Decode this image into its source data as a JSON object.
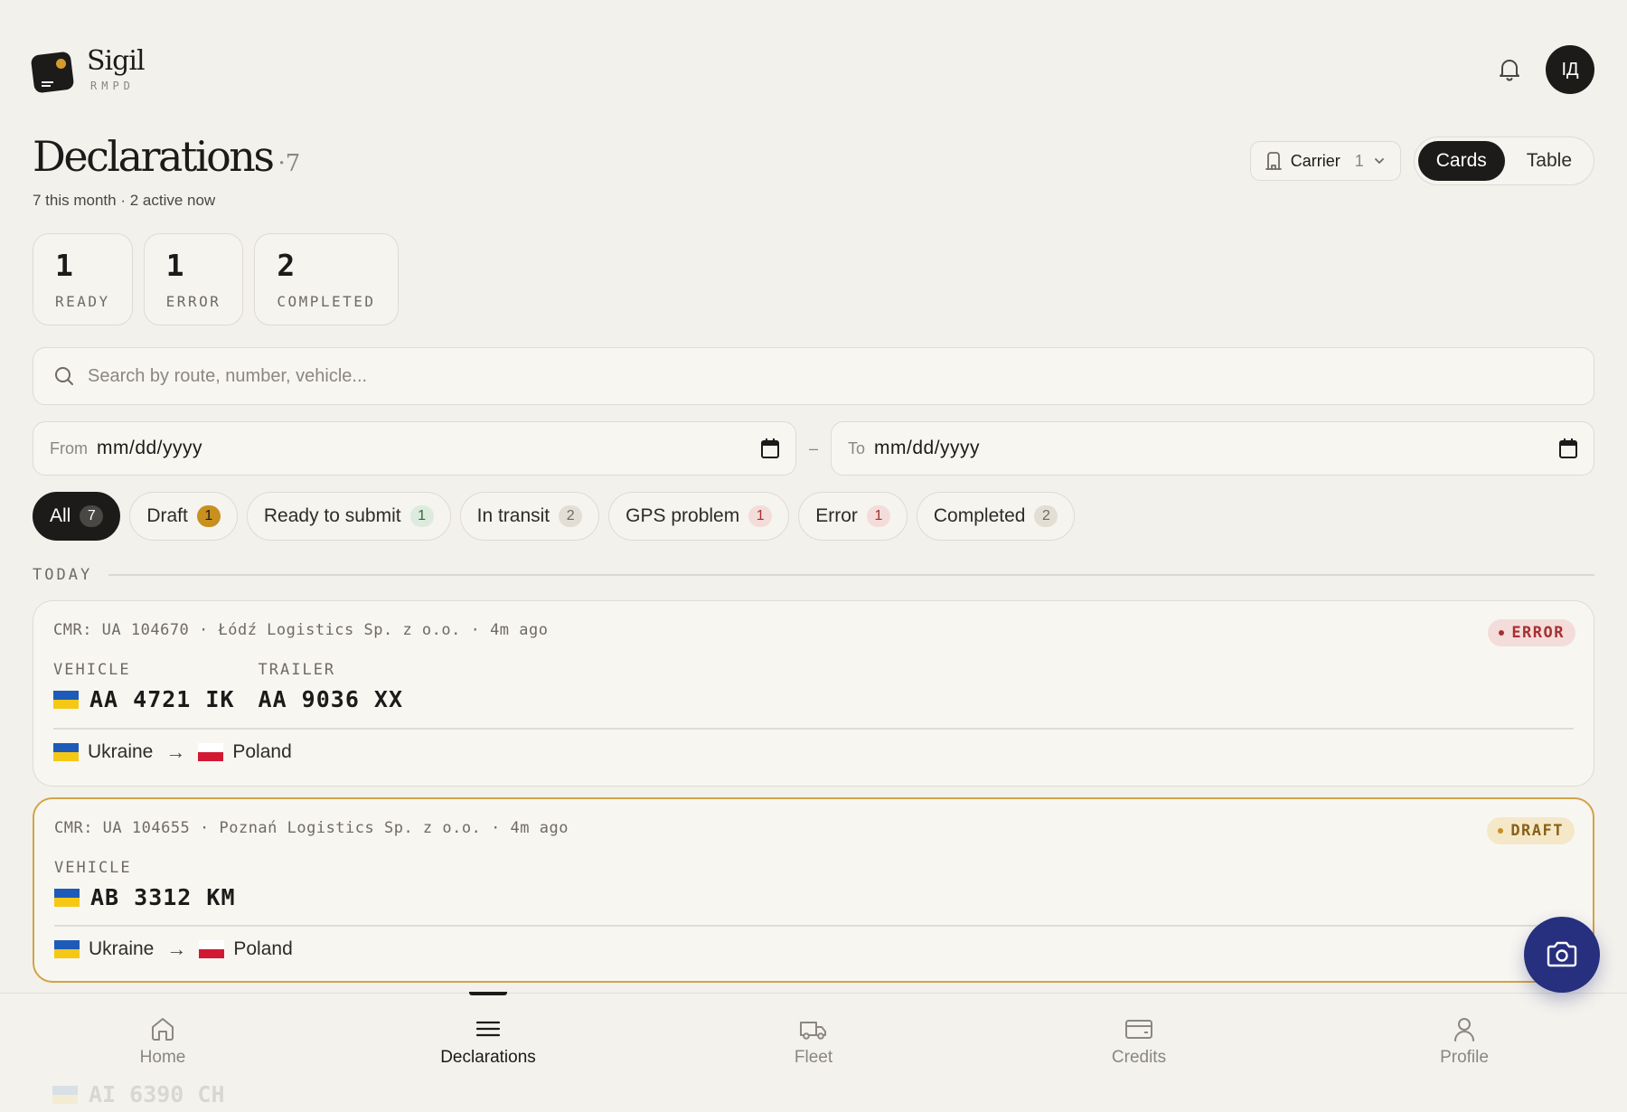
{
  "brand": {
    "name": "Sigil",
    "sub": "RMPD"
  },
  "user": {
    "initials": "ІД"
  },
  "page": {
    "title": "Declarations",
    "count": "·7",
    "subtitle": "7 this month · 2 active now"
  },
  "carrier": {
    "label": "Carrier",
    "count": "1"
  },
  "view_toggle": {
    "options": [
      "Cards",
      "Table"
    ],
    "active": "Cards"
  },
  "stats": [
    {
      "value": "1",
      "label": "READY"
    },
    {
      "value": "1",
      "label": "ERROR"
    },
    {
      "value": "2",
      "label": "COMPLETED"
    }
  ],
  "search": {
    "placeholder": "Search by route, number, vehicle..."
  },
  "dates": {
    "from_label": "From",
    "from_value": "mm/dd/yyyy",
    "separator": "–",
    "to_label": "To",
    "to_value": "mm/dd/yyyy"
  },
  "filters": [
    {
      "label": "All",
      "count": "7",
      "active": true,
      "badge_bg": "#4a4844",
      "badge_fg": "#ffffff"
    },
    {
      "label": "Draft",
      "count": "1",
      "badge_bg": "#c8901e",
      "badge_fg": "#1c1b19"
    },
    {
      "label": "Ready to submit",
      "count": "1",
      "badge_bg": "#dcebdd",
      "badge_fg": "#2f6b3a"
    },
    {
      "label": "In transit",
      "count": "2",
      "badge_bg": "#e2ded3",
      "badge_fg": "#6f6b63"
    },
    {
      "label": "GPS problem",
      "count": "1",
      "badge_bg": "#f4dcda",
      "badge_fg": "#a63030"
    },
    {
      "label": "Error",
      "count": "1",
      "badge_bg": "#f4dcda",
      "badge_fg": "#a63030"
    },
    {
      "label": "Completed",
      "count": "2",
      "badge_bg": "#e2ded3",
      "badge_fg": "#6f6b63"
    }
  ],
  "section": {
    "label": "TODAY"
  },
  "declarations": [
    {
      "meta": "CMR: UA 104670 · Łódź Logistics Sp. z o.o. · 4m ago",
      "status": "ERROR",
      "vehicle_label": "VEHICLE",
      "vehicle": "AA 4721 IK",
      "trailer_label": "TRAILER",
      "trailer": "AA 9036 XX",
      "from": "Ukraine",
      "arrow": "→",
      "to": "Poland"
    },
    {
      "meta": "CMR: UA 104655 · Poznań Logistics Sp. z o.o. · 4m ago",
      "status": "DRAFT",
      "vehicle_label": "VEHICLE",
      "vehicle": "AB 3312 KM",
      "from": "Ukraine",
      "arrow": "→",
      "to": "Poland"
    }
  ],
  "partial_card": {
    "vehicle": "AI 6390 CH"
  },
  "nav": [
    {
      "label": "Home",
      "icon": "home-icon"
    },
    {
      "label": "Declarations",
      "icon": "list-icon",
      "active": true
    },
    {
      "label": "Fleet",
      "icon": "truck-icon"
    },
    {
      "label": "Credits",
      "icon": "credit-card-icon"
    },
    {
      "label": "Profile",
      "icon": "user-icon"
    }
  ],
  "fab": {
    "icon": "camera-icon"
  },
  "colors": {
    "accent": "#26307e",
    "ink": "#1c1b19",
    "background": "#f3f1ec",
    "draft_border": "#d0a447",
    "error": "#a63030"
  }
}
